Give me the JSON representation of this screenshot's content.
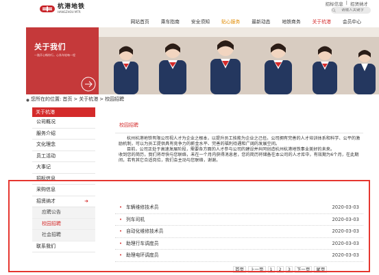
{
  "header": {
    "logo_cn": "杭港地铁",
    "logo_en": "HANGZHOU MTR",
    "top_links": [
      "招标信息",
      "|",
      "招贤纳才"
    ],
    "search_placeholder": "请输入关键字"
  },
  "nav": [
    "网站首页",
    "乘车指南",
    "安全须知",
    "贴心服务",
    "最新动态",
    "地铁商务",
    "关于杭港",
    "会员中心"
  ],
  "banner": {
    "title": "关于我们",
    "subtitle": "一路开心畅你行，心系车轮每一程"
  },
  "breadcrumb": {
    "prefix": "您所在的位置:",
    "items": [
      "首页",
      "关于杭港",
      "校园招聘"
    ]
  },
  "sidebar": {
    "head": "关于杭港",
    "items": [
      "公司概况",
      "服务介绍",
      "文化理念",
      "员工活动",
      "大事记",
      "招标信息",
      "采购信息",
      "招贤纳才"
    ],
    "subitems": [
      "应聘公告",
      "校园招聘",
      "社会招聘"
    ],
    "last_item": "联系我们"
  },
  "main": {
    "title": "校园招聘",
    "paragraphs": [
      "杭州杭港地铁有限公司视人才为企业之根本，以提升员工技能为企业之己任。公司拥有完善的人才培训体系和科学、公平的激励机制，可以为员工提供具有竞争力的薪金水平、完善的福利待遇和广阔的发展空间。",
      "目前，公司正处于高速发展阶段，需要各方面的人才参与公司的建设并共同创造杭州杭港地铁事业美好的未来。",
      "收到您的简历，我们将尽快与您联络，未在一个月内获得消息者，您的简历将储备在本公司的人才库中，有效期为6个月，在此期间，若有其它合适岗位，我们会主动与您联络，谢谢。"
    ]
  },
  "jobs": [
    {
      "title": "车辆维修技术员",
      "date": "2020-03-03"
    },
    {
      "title": "列车司机",
      "date": "2020-03-03"
    },
    {
      "title": "自动化维修技术员",
      "date": "2020-03-03"
    },
    {
      "title": "助理行车调度员",
      "date": "2020-03-03"
    },
    {
      "title": "助理电环调度员",
      "date": "2020-03-03"
    }
  ],
  "pager": [
    "首页",
    "上一页",
    "1",
    "2",
    "3",
    "下一页",
    "尾页"
  ],
  "colors": {
    "brand_red": "#d42a2a",
    "highlight": "#e5352e",
    "nav_orange": "#e08a00"
  }
}
